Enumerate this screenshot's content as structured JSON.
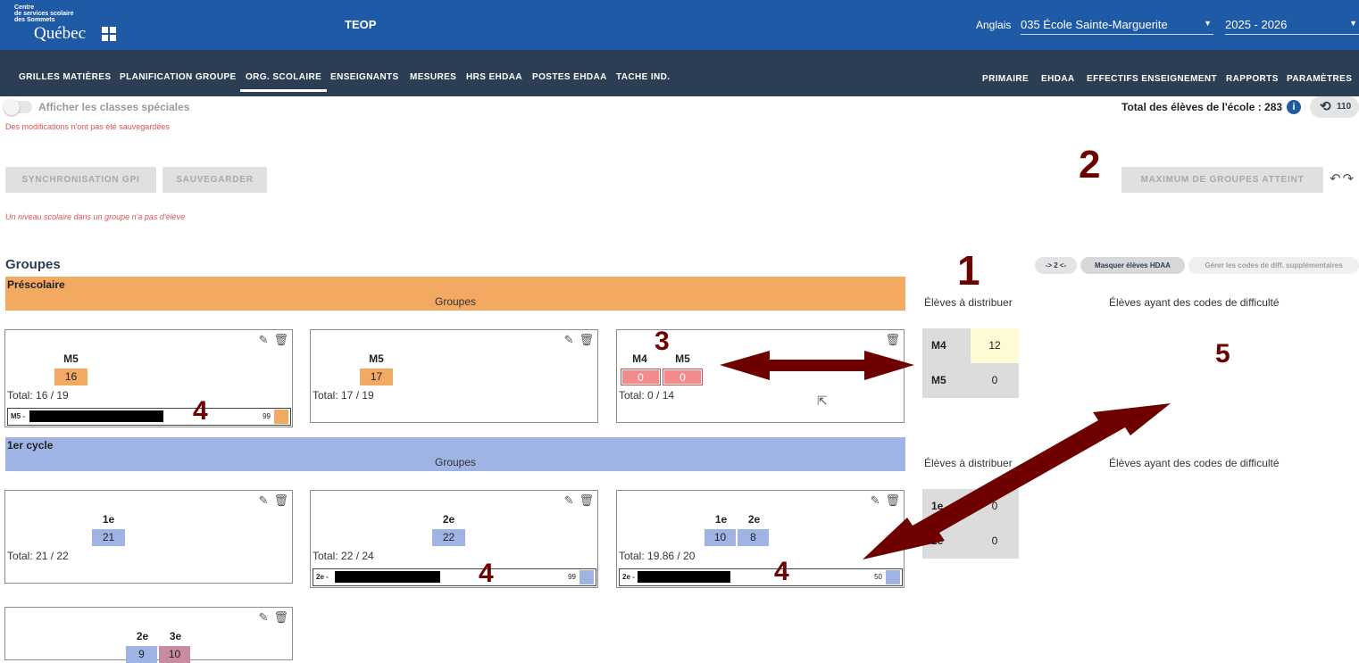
{
  "header": {
    "logo_small_lines": [
      "Centre",
      "de services scolaire",
      "des Sommets"
    ],
    "logo_main": "Québec",
    "app_title": "TEOP",
    "language_label": "Anglais",
    "school_select": "035 École Sainte-Marguerite",
    "year_select": "2025 - 2026",
    "caret": "▼"
  },
  "nav": {
    "left": [
      "GRILLES MATIÈRES",
      "PLANIFICATION GROUPE",
      "ORG. SCOLAIRE",
      "ENSEIGNANTS",
      "MESURES",
      "HRS EHDAA",
      "POSTES EHDAA",
      "TACHE IND."
    ],
    "active": "ORG. SCOLAIRE",
    "right": [
      "PRIMAIRE",
      "EHDAA",
      "EFFECTIFS ENSEIGNEMENT",
      "RAPPORTS",
      "PARAMÈTRES"
    ]
  },
  "toolbar": {
    "toggle_label": "Afficher les classes spéciales",
    "toggle_on": false,
    "unsaved_warning": "Des modifications n'ont pas été sauvegardées",
    "total_label": "Total des élèves de l'école : 283",
    "info_icon_glyph": "i",
    "history_count": "110",
    "sync_button": "SYNCHRONISATION GPI",
    "save_button": "SAUVEGARDER",
    "max_groups_button": "MAXIMUM DE GROUPES ATTEINT",
    "level_warning": "Un niveau scolaire dans un groupe n'a pas d'élève"
  },
  "groups_section": {
    "title": "Groupes",
    "chip_level": "-> 2 <-",
    "chip_hide_hdaa": "Masquer élèves HDAA",
    "chip_manage_codes": "Gérer les codes de diff. supplémentaires"
  },
  "prescolaire": {
    "name": "Préscolaire",
    "subtitle": "Groupes",
    "side_distribute": "Élèves à distribuer",
    "side_difficulty": "Élèves ayant des codes de difficulté",
    "cards": [
      {
        "levels": [
          "M5"
        ],
        "counts": [
          "16"
        ],
        "total": "Total: 16 / 19",
        "student_code": "M5 -",
        "student_num": "99"
      },
      {
        "levels": [
          "M5"
        ],
        "counts": [
          "17"
        ],
        "total": "Total: 17 / 19"
      },
      {
        "levels": [
          "M4",
          "M5"
        ],
        "counts": [
          "0",
          "0"
        ],
        "total": "Total: 0 / 14"
      }
    ],
    "distribute": [
      {
        "level": "M4",
        "value": "12"
      },
      {
        "level": "M5",
        "value": "0"
      }
    ]
  },
  "cycle1": {
    "name": "1er cycle",
    "subtitle": "Groupes",
    "side_distribute": "Élèves à distribuer",
    "side_difficulty": "Élèves ayant des codes de difficulté",
    "cards": [
      {
        "levels": [
          "1e"
        ],
        "counts": [
          "21"
        ],
        "total": "Total: 21 / 22"
      },
      {
        "levels": [
          "2e"
        ],
        "counts": [
          "22"
        ],
        "total": "Total: 22 / 24",
        "student_code": "2e -",
        "student_num": "99"
      },
      {
        "levels": [
          "1e",
          "2e"
        ],
        "counts": [
          "10",
          "8"
        ],
        "total": "Total: 19.86 / 20",
        "student_code": "2e -",
        "student_num": "50"
      },
      {
        "levels": [
          "2e",
          "3e"
        ],
        "counts": [
          "9",
          "10"
        ]
      }
    ],
    "distribute": [
      {
        "level": "1e",
        "value": "0"
      },
      {
        "level": "2e",
        "value": "0"
      }
    ]
  },
  "annotations": [
    "1",
    "2",
    "3",
    "4",
    "5"
  ],
  "colors": {
    "header_blue": "#1f5aa6",
    "nav_dark": "#2c3e53",
    "prescolaire_orange": "#f2a962",
    "cycle_blue": "#9fb4e4",
    "error_red": "#e35353",
    "annotation_maroon": "#6e0000"
  },
  "icons": {
    "edit": "pencil-icon",
    "delete": "trash-icon",
    "history": "history-icon",
    "undo": "undo-icon",
    "redo": "redo-icon",
    "info": "info-icon"
  }
}
